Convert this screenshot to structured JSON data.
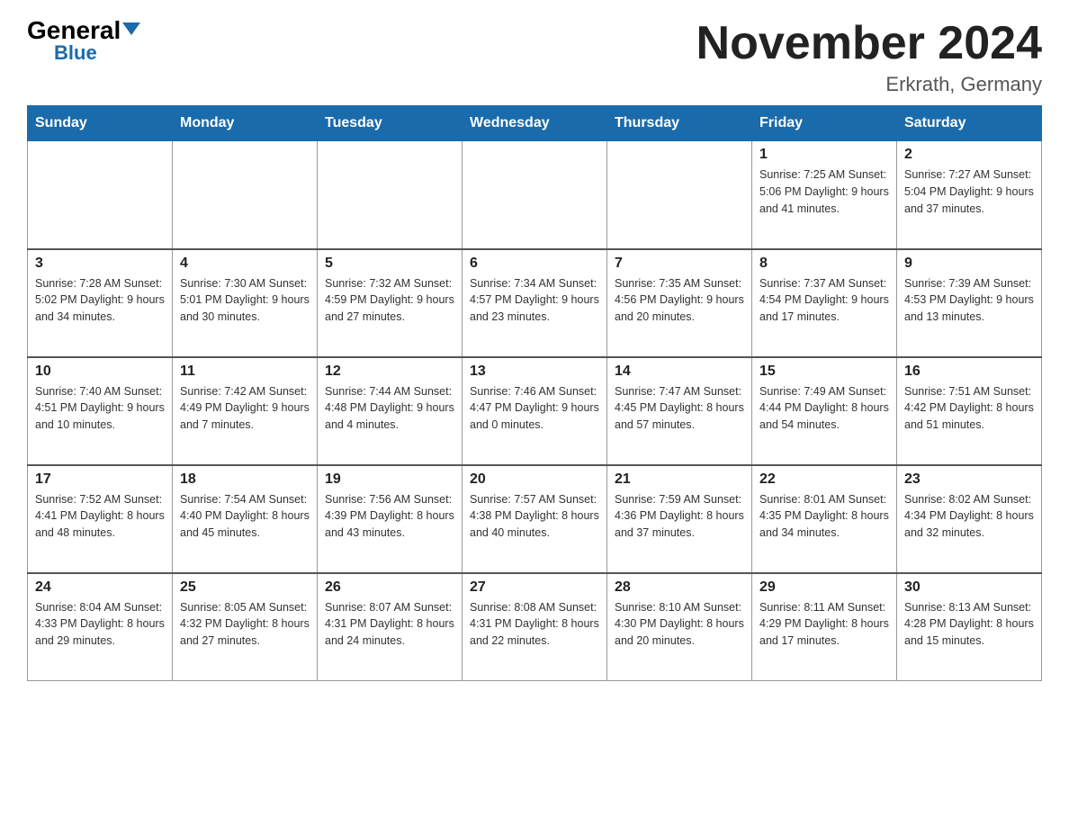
{
  "header": {
    "logo_general": "General",
    "logo_blue": "Blue",
    "month_title": "November 2024",
    "location": "Erkrath, Germany"
  },
  "days_of_week": [
    "Sunday",
    "Monday",
    "Tuesday",
    "Wednesday",
    "Thursday",
    "Friday",
    "Saturday"
  ],
  "weeks": [
    [
      {
        "day": "",
        "info": ""
      },
      {
        "day": "",
        "info": ""
      },
      {
        "day": "",
        "info": ""
      },
      {
        "day": "",
        "info": ""
      },
      {
        "day": "",
        "info": ""
      },
      {
        "day": "1",
        "info": "Sunrise: 7:25 AM\nSunset: 5:06 PM\nDaylight: 9 hours and 41 minutes."
      },
      {
        "day": "2",
        "info": "Sunrise: 7:27 AM\nSunset: 5:04 PM\nDaylight: 9 hours and 37 minutes."
      }
    ],
    [
      {
        "day": "3",
        "info": "Sunrise: 7:28 AM\nSunset: 5:02 PM\nDaylight: 9 hours and 34 minutes."
      },
      {
        "day": "4",
        "info": "Sunrise: 7:30 AM\nSunset: 5:01 PM\nDaylight: 9 hours and 30 minutes."
      },
      {
        "day": "5",
        "info": "Sunrise: 7:32 AM\nSunset: 4:59 PM\nDaylight: 9 hours and 27 minutes."
      },
      {
        "day": "6",
        "info": "Sunrise: 7:34 AM\nSunset: 4:57 PM\nDaylight: 9 hours and 23 minutes."
      },
      {
        "day": "7",
        "info": "Sunrise: 7:35 AM\nSunset: 4:56 PM\nDaylight: 9 hours and 20 minutes."
      },
      {
        "day": "8",
        "info": "Sunrise: 7:37 AM\nSunset: 4:54 PM\nDaylight: 9 hours and 17 minutes."
      },
      {
        "day": "9",
        "info": "Sunrise: 7:39 AM\nSunset: 4:53 PM\nDaylight: 9 hours and 13 minutes."
      }
    ],
    [
      {
        "day": "10",
        "info": "Sunrise: 7:40 AM\nSunset: 4:51 PM\nDaylight: 9 hours and 10 minutes."
      },
      {
        "day": "11",
        "info": "Sunrise: 7:42 AM\nSunset: 4:49 PM\nDaylight: 9 hours and 7 minutes."
      },
      {
        "day": "12",
        "info": "Sunrise: 7:44 AM\nSunset: 4:48 PM\nDaylight: 9 hours and 4 minutes."
      },
      {
        "day": "13",
        "info": "Sunrise: 7:46 AM\nSunset: 4:47 PM\nDaylight: 9 hours and 0 minutes."
      },
      {
        "day": "14",
        "info": "Sunrise: 7:47 AM\nSunset: 4:45 PM\nDaylight: 8 hours and 57 minutes."
      },
      {
        "day": "15",
        "info": "Sunrise: 7:49 AM\nSunset: 4:44 PM\nDaylight: 8 hours and 54 minutes."
      },
      {
        "day": "16",
        "info": "Sunrise: 7:51 AM\nSunset: 4:42 PM\nDaylight: 8 hours and 51 minutes."
      }
    ],
    [
      {
        "day": "17",
        "info": "Sunrise: 7:52 AM\nSunset: 4:41 PM\nDaylight: 8 hours and 48 minutes."
      },
      {
        "day": "18",
        "info": "Sunrise: 7:54 AM\nSunset: 4:40 PM\nDaylight: 8 hours and 45 minutes."
      },
      {
        "day": "19",
        "info": "Sunrise: 7:56 AM\nSunset: 4:39 PM\nDaylight: 8 hours and 43 minutes."
      },
      {
        "day": "20",
        "info": "Sunrise: 7:57 AM\nSunset: 4:38 PM\nDaylight: 8 hours and 40 minutes."
      },
      {
        "day": "21",
        "info": "Sunrise: 7:59 AM\nSunset: 4:36 PM\nDaylight: 8 hours and 37 minutes."
      },
      {
        "day": "22",
        "info": "Sunrise: 8:01 AM\nSunset: 4:35 PM\nDaylight: 8 hours and 34 minutes."
      },
      {
        "day": "23",
        "info": "Sunrise: 8:02 AM\nSunset: 4:34 PM\nDaylight: 8 hours and 32 minutes."
      }
    ],
    [
      {
        "day": "24",
        "info": "Sunrise: 8:04 AM\nSunset: 4:33 PM\nDaylight: 8 hours and 29 minutes."
      },
      {
        "day": "25",
        "info": "Sunrise: 8:05 AM\nSunset: 4:32 PM\nDaylight: 8 hours and 27 minutes."
      },
      {
        "day": "26",
        "info": "Sunrise: 8:07 AM\nSunset: 4:31 PM\nDaylight: 8 hours and 24 minutes."
      },
      {
        "day": "27",
        "info": "Sunrise: 8:08 AM\nSunset: 4:31 PM\nDaylight: 8 hours and 22 minutes."
      },
      {
        "day": "28",
        "info": "Sunrise: 8:10 AM\nSunset: 4:30 PM\nDaylight: 8 hours and 20 minutes."
      },
      {
        "day": "29",
        "info": "Sunrise: 8:11 AM\nSunset: 4:29 PM\nDaylight: 8 hours and 17 minutes."
      },
      {
        "day": "30",
        "info": "Sunrise: 8:13 AM\nSunset: 4:28 PM\nDaylight: 8 hours and 15 minutes."
      }
    ]
  ]
}
